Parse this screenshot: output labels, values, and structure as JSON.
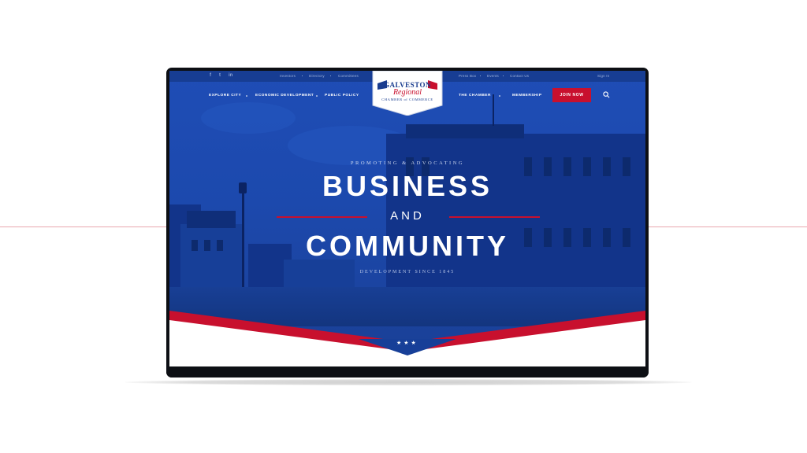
{
  "site": {
    "logo": {
      "line1": "GALVESTON",
      "line2": "Regional",
      "line3": "CHAMBER of COMMERCE"
    }
  },
  "topbar": {
    "social": [
      "f",
      "t",
      "in"
    ],
    "left_links": [
      "Investors",
      "Directory",
      "Committees"
    ],
    "right_links": [
      "Press Box",
      "Events",
      "Contact Us"
    ],
    "sign_in": "Sign In"
  },
  "nav": {
    "left": [
      "EXPLORE CITY",
      "ECONOMIC DEVELOPMENT",
      "PUBLIC POLICY"
    ],
    "right": [
      "THE CHAMBER",
      "MEMBERSHIP"
    ],
    "join_label": "JOIN NOW"
  },
  "hero": {
    "kicker": "PROMOTING & ADVOCATING",
    "line1": "BUSINESS",
    "and": "AND",
    "line2": "COMMUNITY",
    "since": "DEVELOPMENT SINCE 1845",
    "stars": "★★★"
  },
  "colors": {
    "primary_blue": "#1f4db6",
    "accent_red": "#c8102e",
    "navy": "#1a3d8f"
  }
}
